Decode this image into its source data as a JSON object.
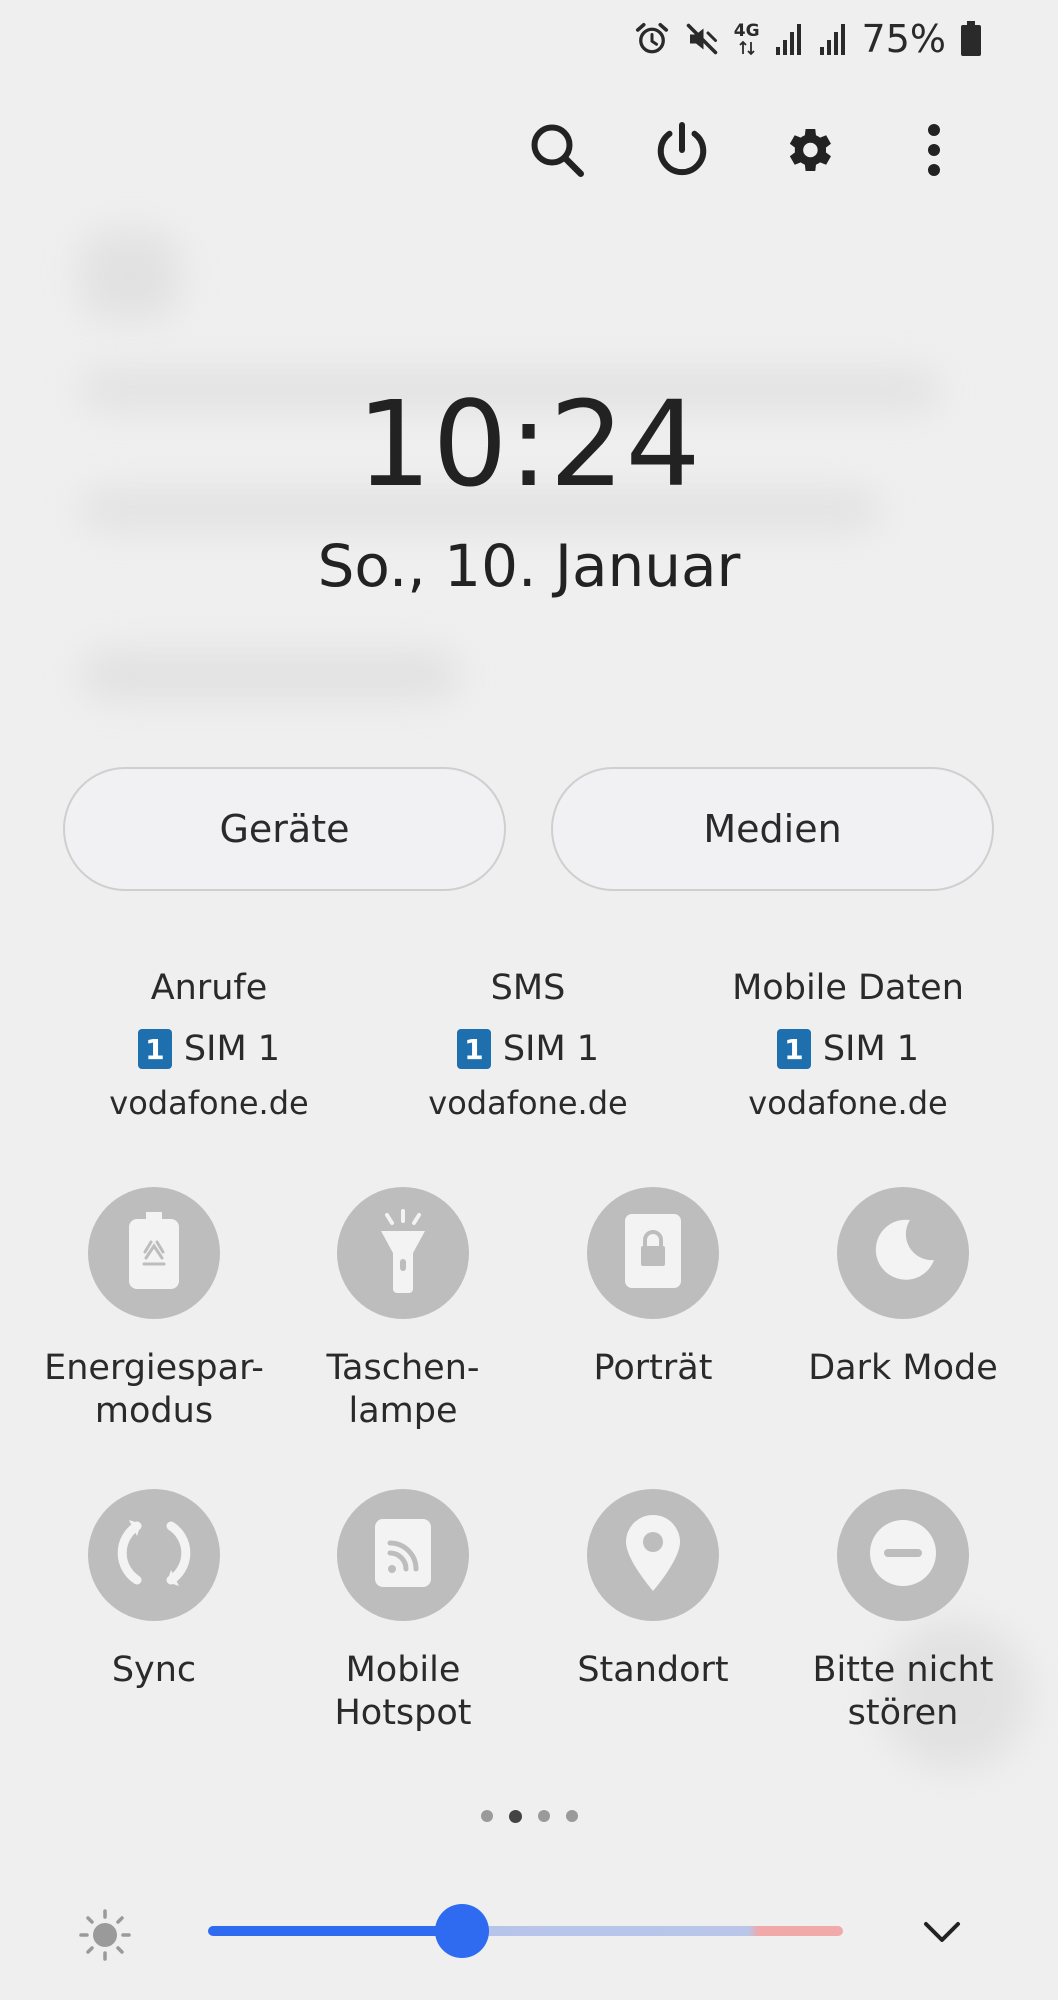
{
  "status_bar": {
    "network": "4G",
    "battery_percent": "75%",
    "icons": [
      "alarm-icon",
      "mute-icon",
      "network-4g-icon",
      "signal-icon",
      "signal-icon",
      "battery-icon"
    ]
  },
  "top_actions": [
    "search-icon",
    "power-icon",
    "gear-icon",
    "more-vert-icon"
  ],
  "clock": {
    "time": "10:24",
    "date": "So., 10. Januar"
  },
  "panel_buttons": {
    "devices": "Geräte",
    "media": "Medien"
  },
  "sim_info": [
    {
      "title": "Anrufe",
      "sim_number": "1",
      "sim_label": "SIM 1",
      "carrier": "vodafone.de"
    },
    {
      "title": "SMS",
      "sim_number": "1",
      "sim_label": "SIM 1",
      "carrier": "vodafone.de"
    },
    {
      "title": "Mobile Daten",
      "sim_number": "1",
      "sim_label": "SIM 1",
      "carrier": "vodafone.de"
    }
  ],
  "quick_tiles": [
    {
      "label": "Energiespar-\nmodus",
      "icon": "battery-saver-icon"
    },
    {
      "label": "Taschen-\nlampe",
      "icon": "flashlight-icon"
    },
    {
      "label": "Porträt",
      "icon": "rotation-lock-icon"
    },
    {
      "label": "Dark Mode",
      "icon": "moon-icon"
    },
    {
      "label": "Sync",
      "icon": "sync-icon"
    },
    {
      "label": "Mobile\nHotspot",
      "icon": "hotspot-icon"
    },
    {
      "label": "Standort",
      "icon": "location-icon"
    },
    {
      "label": "Bitte nicht\nstören",
      "icon": "do-not-disturb-icon"
    }
  ],
  "pager": {
    "pages": 4,
    "active_index": 1
  },
  "brightness": {
    "level": 0.4
  },
  "colors": {
    "accent": "#2f6bf0",
    "tile_off": "#bdbdbd",
    "sim_badge": "#1e6fae",
    "background": "#efefef"
  }
}
